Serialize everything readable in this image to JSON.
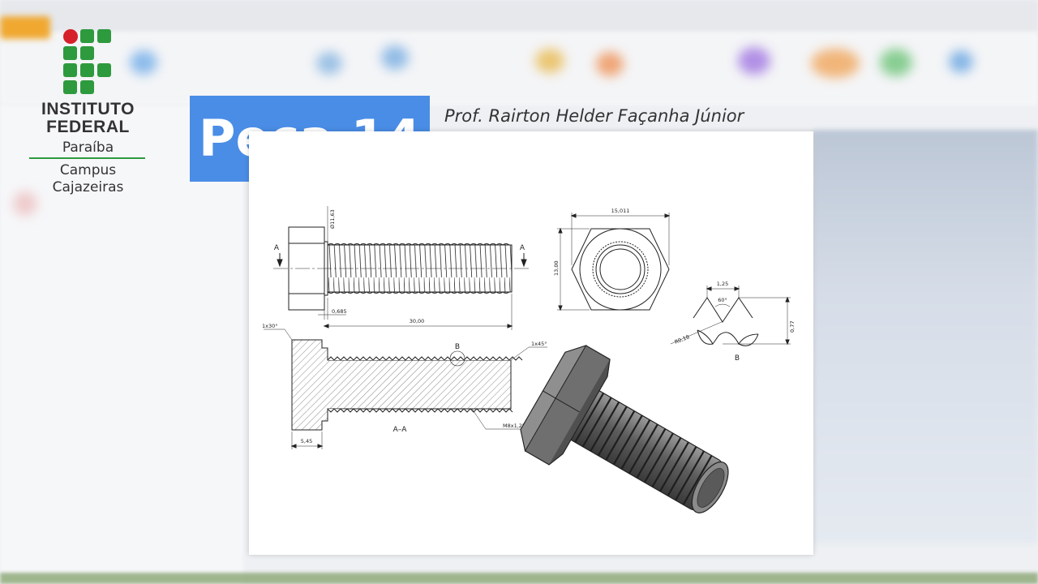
{
  "logo": {
    "line1": "INSTITUTO",
    "line2": "FEDERAL",
    "state": "Paraíba",
    "campus_line1": "Campus",
    "campus_line2": "Cajazeiras",
    "colors": {
      "green": "#2e9a3e",
      "red": "#d6212a"
    }
  },
  "title": {
    "text": "Peça 14",
    "background": "#4a8de6"
  },
  "author": "Prof. Rairton Helder Façanha Júnior",
  "drawing": {
    "front_view": {
      "section_mark_left": "A",
      "section_mark_right": "A",
      "dim_diameter": "Ø11,63",
      "dim_small": "0,685",
      "dim_length": "30,00"
    },
    "end_view": {
      "dim_width": "15,011",
      "dim_height": "13,00"
    },
    "detail_b": {
      "pitch": "1,25",
      "angle": "60°",
      "depth": "0,77",
      "radius": "R0,18",
      "label": "B"
    },
    "section_view": {
      "chamfer_head": "1x30°",
      "chamfer_tip": "1x45°",
      "detail_callout": "B",
      "thread_spec": "M8x1,25",
      "head_length": "5,45",
      "label": "A–A"
    },
    "iso_view": {
      "icon": "hex-bolt-3d-icon"
    }
  }
}
